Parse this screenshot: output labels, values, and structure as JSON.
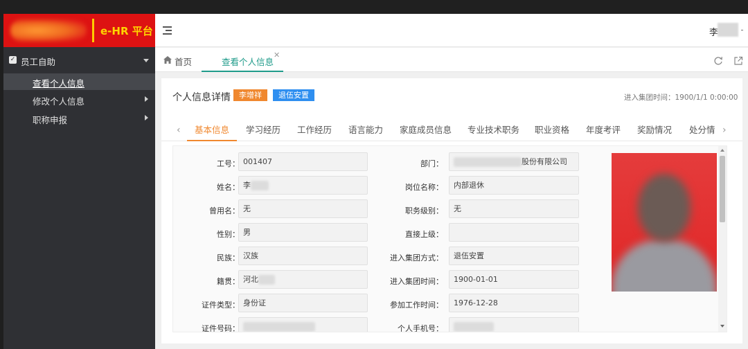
{
  "app": {
    "logo_text": "e-HR 平台",
    "user_name": "李"
  },
  "sidebar": {
    "group": "员工自助",
    "items": [
      {
        "label": "查看个人信息",
        "active": true
      },
      {
        "label": "修改个人信息",
        "active": false
      },
      {
        "label": "职称申报",
        "active": false
      }
    ]
  },
  "tabs": {
    "home": "首页",
    "current": "查看个人信息"
  },
  "card": {
    "title": "个人信息详情",
    "badge_name": "李增祥",
    "badge_status": "退伍安置",
    "join_time": "进入集团时间：1900/1/1 0:00:00"
  },
  "subtabs": [
    "基本信息",
    "学习经历",
    "工作经历",
    "语言能力",
    "家庭成员信息",
    "专业技术职务",
    "职业资格",
    "年度考评",
    "奖励情况",
    "处分情"
  ],
  "form": {
    "left": [
      {
        "label": "工号：",
        "value": "001407"
      },
      {
        "label": "姓名：",
        "value": "李"
      },
      {
        "label": "曾用名：",
        "value": "无"
      },
      {
        "label": "性别：",
        "value": "男"
      },
      {
        "label": "民族：",
        "value": "汉族"
      },
      {
        "label": "籍贯：",
        "value": "河北"
      },
      {
        "label": "证件类型：",
        "value": "身份证"
      },
      {
        "label": "证件号码：",
        "value": ""
      }
    ],
    "right": [
      {
        "label": "部门：",
        "value": "股份有限公司"
      },
      {
        "label": "岗位名称：",
        "value": "内部退休"
      },
      {
        "label": "职务级别：",
        "value": "无"
      },
      {
        "label": "直接上级：",
        "value": ""
      },
      {
        "label": "进入集团方式：",
        "value": "退伍安置"
      },
      {
        "label": "进入集团时间：",
        "value": "1900-01-01"
      },
      {
        "label": "参加工作时间：",
        "value": "1976-12-28"
      },
      {
        "label": "个人手机号：",
        "value": ""
      }
    ]
  },
  "colors": {
    "accent": "#1f9b8a",
    "orange": "#f0882f",
    "blue": "#2f8ff0",
    "logo_red": "#dd1212",
    "logo_yellow": "#ffd400"
  }
}
